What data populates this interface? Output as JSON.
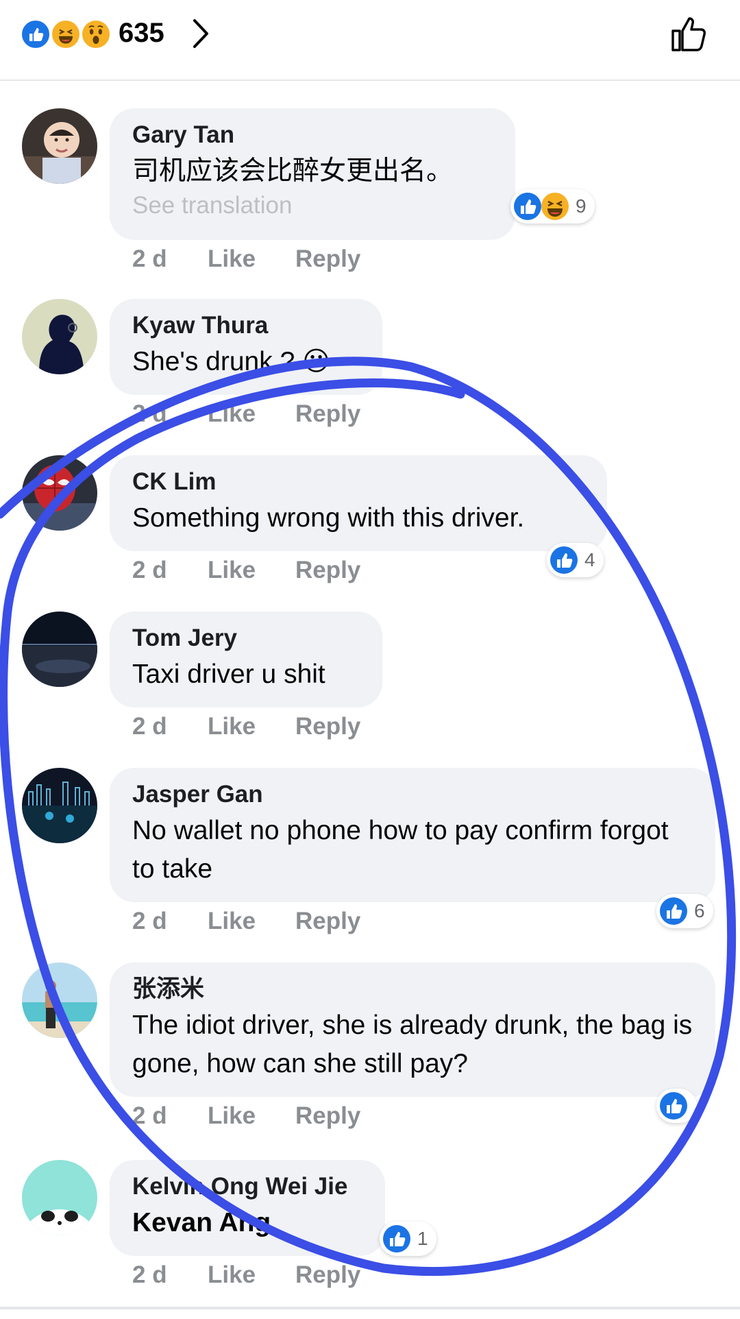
{
  "header": {
    "reactions": [
      "like-icon",
      "haha-icon",
      "wow-icon"
    ],
    "reaction_count": "635"
  },
  "comments": [
    {
      "author": "Gary Tan",
      "text": "司机应该会比醉女更出名。",
      "see_translation": "See translation",
      "age": "2 d",
      "like": "Like",
      "reply": "Reply",
      "reaction_count": "9",
      "reactions": [
        "like-icon",
        "haha-icon"
      ]
    },
    {
      "author": "Kyaw Thura",
      "text": "She's drunk ? 😮",
      "age": "2 d",
      "like": "Like",
      "reply": "Reply"
    },
    {
      "author": "CK Lim",
      "text": "Something wrong with this driver.",
      "age": "2 d",
      "like": "Like",
      "reply": "Reply",
      "reaction_count": "4",
      "reactions": [
        "like-icon"
      ]
    },
    {
      "author": "Tom Jery",
      "text": "Taxi driver u shit",
      "age": "2 d",
      "like": "Like",
      "reply": "Reply"
    },
    {
      "author": "Jasper Gan",
      "text": "No wallet no phone how to pay confirm forgot to take",
      "age": "2 d",
      "like": "Like",
      "reply": "Reply",
      "reaction_count": "6",
      "reactions": [
        "like-icon"
      ]
    },
    {
      "author": "张添米",
      "text": "The idiot driver, she is already drunk, the bag is gone, how can she still pay?",
      "age": "2 d",
      "like": "Like",
      "reply": "Reply",
      "reactions": [
        "like-icon"
      ]
    },
    {
      "author": "Kelvin Ong Wei Jie",
      "text": "Kevan Ang",
      "age": "2 d",
      "like": "Like",
      "reply": "Reply",
      "reaction_count": "1",
      "reactions": [
        "like-icon"
      ]
    }
  ],
  "colors": {
    "like_blue": "#1b74e4",
    "bubble_bg": "#f0f2f5",
    "meta_gray": "#8a8d91",
    "annotation_ink": "#3b4ee6"
  }
}
